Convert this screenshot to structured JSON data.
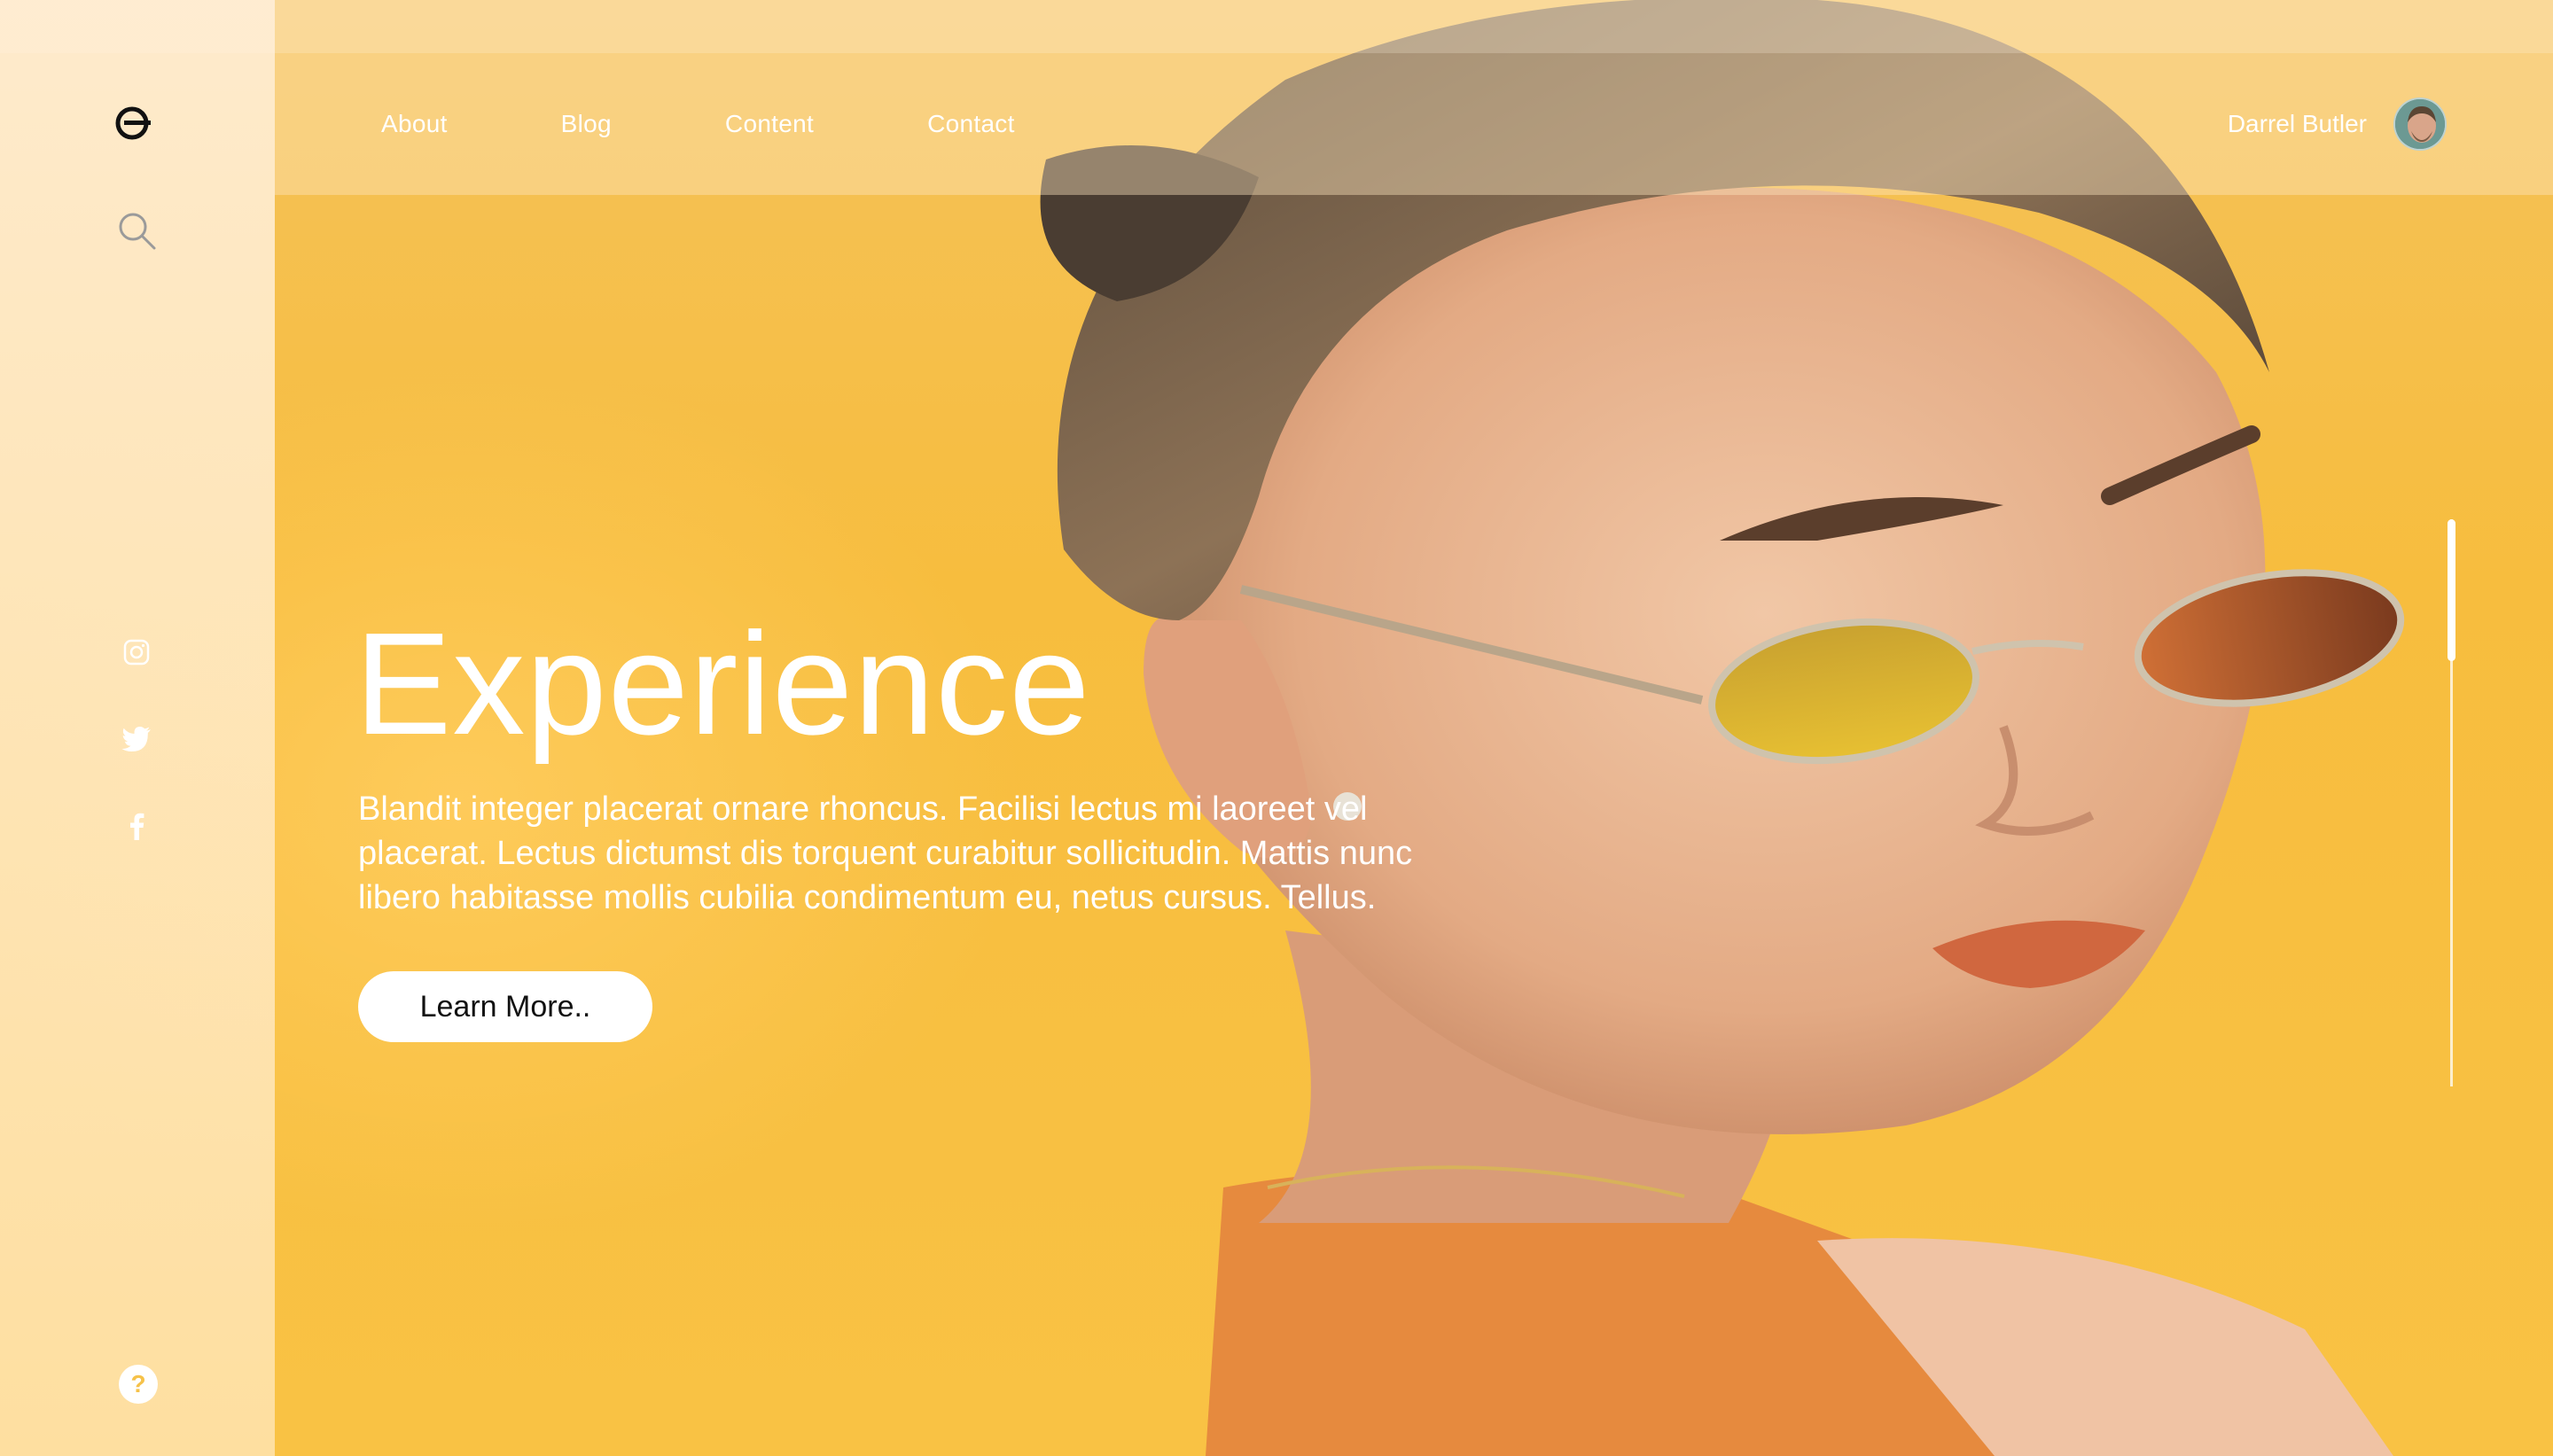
{
  "nav": {
    "links": [
      "About",
      "Blog",
      "Content",
      "Contact"
    ]
  },
  "user": {
    "name": "Darrel Butler"
  },
  "hero": {
    "title": "Experience",
    "body": "Blandit integer placerat ornare rhoncus. Facilisi lectus mi laoreet vel placerat. Lectus dictumst dis torquent curabitur sollicitudin. Mattis nunc libero habitasse mollis cubilia condimentum eu, netus cursus. Tellus.",
    "cta_label": "Learn More.."
  },
  "sidebar": {
    "icons": [
      "logo-icon",
      "search-icon",
      "instagram-icon",
      "twitter-icon",
      "facebook-icon",
      "help-icon"
    ],
    "help_glyph": "?"
  },
  "colors": {
    "accent": "#f6c24a",
    "text_light": "#ffffff",
    "button_text": "#111111"
  },
  "scroll": {
    "position_fraction": 0.25
  }
}
